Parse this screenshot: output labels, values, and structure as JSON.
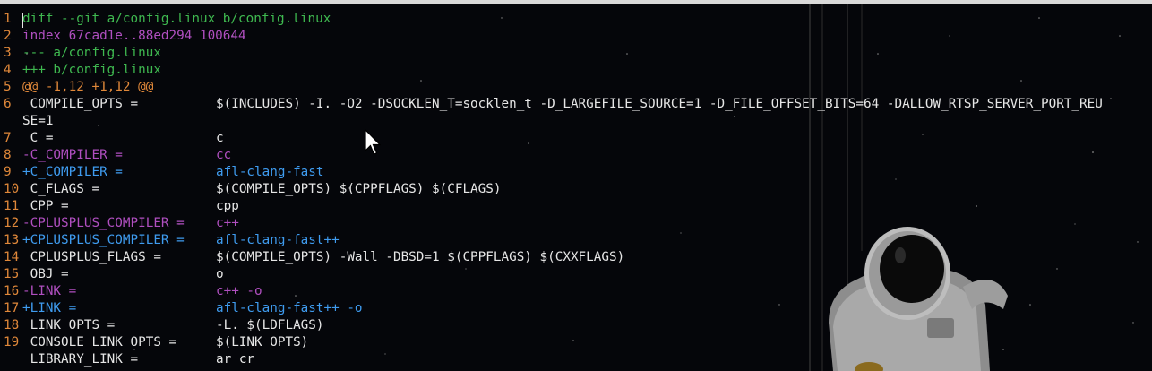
{
  "lines": [
    {
      "num": "1",
      "text": "diff --git a/config.linux b/config.linux",
      "value": "",
      "color": "#3fb950"
    },
    {
      "num": "2",
      "text": "index 67cad1e..88ed294 100644",
      "value": "",
      "color": "#b04fc0"
    },
    {
      "num": "3",
      "text": "--- a/config.linux",
      "value": "",
      "color": "#3fb950"
    },
    {
      "num": "4",
      "text": "+++ b/config.linux",
      "value": "",
      "color": "#3fb950"
    },
    {
      "num": "5",
      "text": "@@ -1,12 +1,12 @@",
      "value": "",
      "color": "#e0883a"
    },
    {
      "num": "6",
      "text": " COMPILE_OPTS =",
      "value": "$(INCLUDES) -I. -O2 -DSOCKLEN_T=socklen_t -D_LARGEFILE_SOURCE=1 -D_FILE_OFFSET_BITS=64 -DALLOW_RTSP_SERVER_PORT_REU",
      "wrap": "SE=1",
      "color": "#e6e6e6"
    },
    {
      "num": "7",
      "text": " C =",
      "value": "c",
      "color": "#e6e6e6"
    },
    {
      "num": "8",
      "text": "-C_COMPILER =",
      "value": "cc",
      "color": "#b04fc0"
    },
    {
      "num": "9",
      "text": "+C_COMPILER =",
      "value": "afl-clang-fast",
      "color": "#3f9cf0"
    },
    {
      "num": "10",
      "text": " C_FLAGS =",
      "value": "$(COMPILE_OPTS) $(CPPFLAGS) $(CFLAGS)",
      "color": "#e6e6e6"
    },
    {
      "num": "11",
      "text": " CPP =",
      "value": "cpp",
      "color": "#e6e6e6"
    },
    {
      "num": "12",
      "text": "-CPLUSPLUS_COMPILER =",
      "value": "c++",
      "color": "#b04fc0"
    },
    {
      "num": "13",
      "text": "+CPLUSPLUS_COMPILER =",
      "value": "afl-clang-fast++",
      "color": "#3f9cf0"
    },
    {
      "num": "14",
      "text": " CPLUSPLUS_FLAGS =",
      "value": "$(COMPILE_OPTS) -Wall -DBSD=1 $(CPPFLAGS) $(CXXFLAGS)",
      "color": "#e6e6e6"
    },
    {
      "num": "15",
      "text": " OBJ =",
      "value": "o",
      "color": "#e6e6e6"
    },
    {
      "num": "16",
      "text": "-LINK =",
      "value": "c++ -o",
      "color": "#b04fc0"
    },
    {
      "num": "17",
      "text": "+LINK =",
      "value": "afl-clang-fast++ -o",
      "color": "#3f9cf0"
    },
    {
      "num": "18",
      "text": " LINK_OPTS =",
      "value": "-L. $(LDFLAGS)",
      "color": "#e6e6e6"
    },
    {
      "num": "19",
      "text": " CONSOLE_LINK_OPTS =",
      "value": "$(LINK_OPTS)",
      "color": "#e6e6e6"
    },
    {
      "num": "",
      "text": " LIBRARY_LINK =",
      "value": "ar cr",
      "color": "#e6e6e6"
    }
  ],
  "icons": {
    "cursor": "mouse-pointer-icon",
    "wallpaper": "astronaut-wallpaper"
  },
  "colors": {
    "line_number": "#e0883a",
    "background": "#05060a"
  }
}
